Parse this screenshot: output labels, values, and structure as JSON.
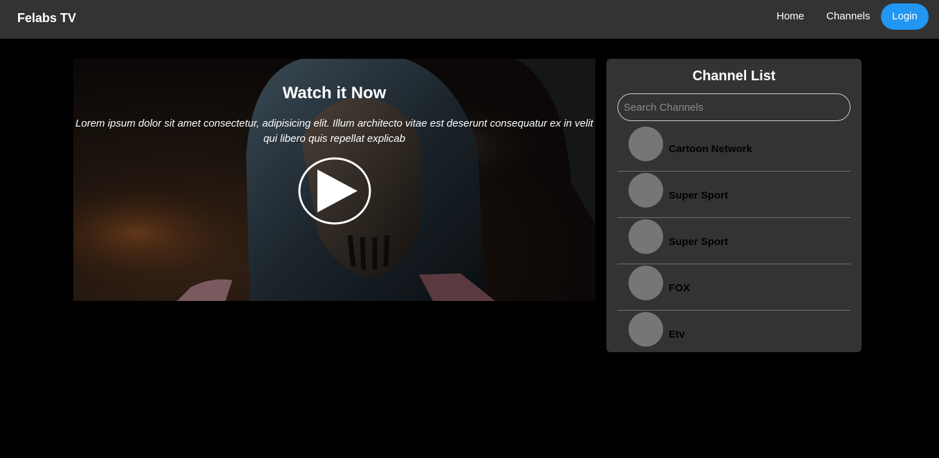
{
  "navbar": {
    "brand": "Felabs TV",
    "links": [
      {
        "label": "Home"
      },
      {
        "label": "Channels"
      }
    ],
    "login_label": "Login"
  },
  "hero": {
    "title": "Watch it Now",
    "description": "Lorem ipsum dolor sit amet consectetur, adipisicing elit. Illum architecto vitae est deserunt consequatur ex in velit qui libero quis repellat explicab",
    "play_icon": "play-circle-icon"
  },
  "channels": {
    "title": "Channel List",
    "search_placeholder": "Search Channels",
    "search_value": "",
    "items": [
      {
        "name": "Cartoon Network"
      },
      {
        "name": "Super Sport"
      },
      {
        "name": "Super Sport"
      },
      {
        "name": "FOX"
      },
      {
        "name": "Etv"
      }
    ]
  },
  "colors": {
    "page_background": "#000000",
    "navbar_background": "#333333",
    "accent": "#2196F3",
    "panel_background": "#333333",
    "avatar_placeholder": "#767676"
  }
}
